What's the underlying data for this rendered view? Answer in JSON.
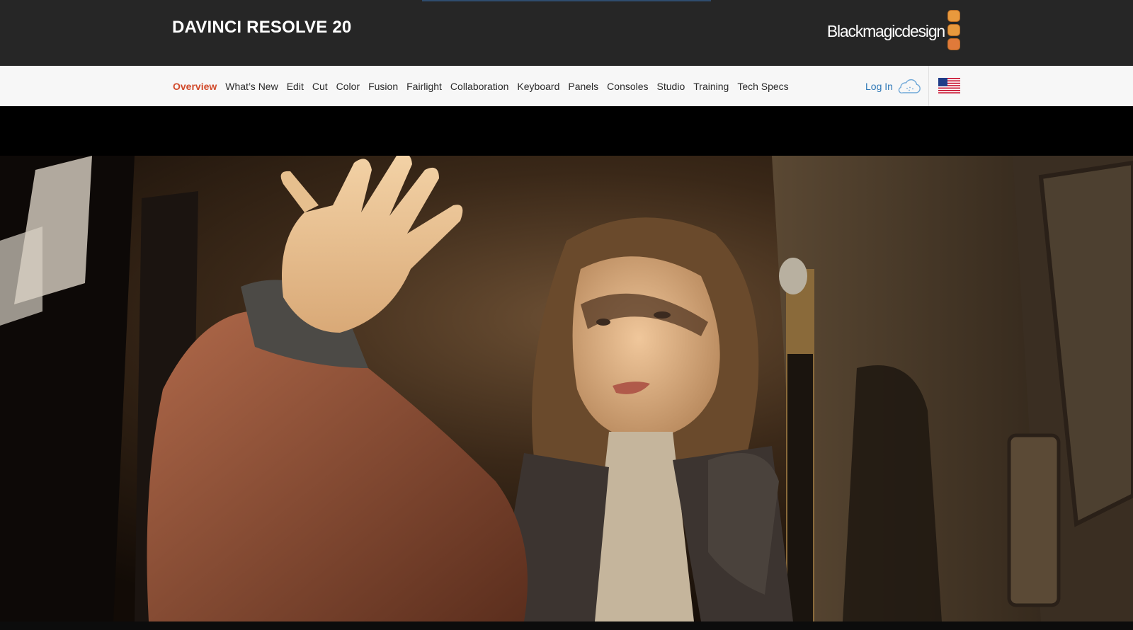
{
  "header": {
    "product_title": "DAVINCI RESOLVE 20",
    "brand": {
      "name": "Blackmagicdesign",
      "logo_icon": "blackmagic-squares-icon",
      "logo_color": "#e8993d"
    }
  },
  "nav": {
    "items": [
      {
        "label": "Overview",
        "active": true
      },
      {
        "label": "What’s New"
      },
      {
        "label": "Edit"
      },
      {
        "label": "Cut"
      },
      {
        "label": "Color"
      },
      {
        "label": "Fusion"
      },
      {
        "label": "Fairlight"
      },
      {
        "label": "Collaboration"
      },
      {
        "label": "Keyboard"
      },
      {
        "label": "Panels"
      },
      {
        "label": "Consoles"
      },
      {
        "label": "Studio"
      },
      {
        "label": "Training"
      },
      {
        "label": "Tech Specs"
      }
    ],
    "login_label": "Log In",
    "login_icon": "cloud-icon",
    "region_icon": "us-flag-icon"
  },
  "colors": {
    "header_bg": "#262626",
    "nav_bg": "#f7f7f7",
    "active_nav": "#d14a2b",
    "login_link": "#2f78b7"
  },
  "hero": {
    "image": "film-still-girl-raising-hand"
  }
}
